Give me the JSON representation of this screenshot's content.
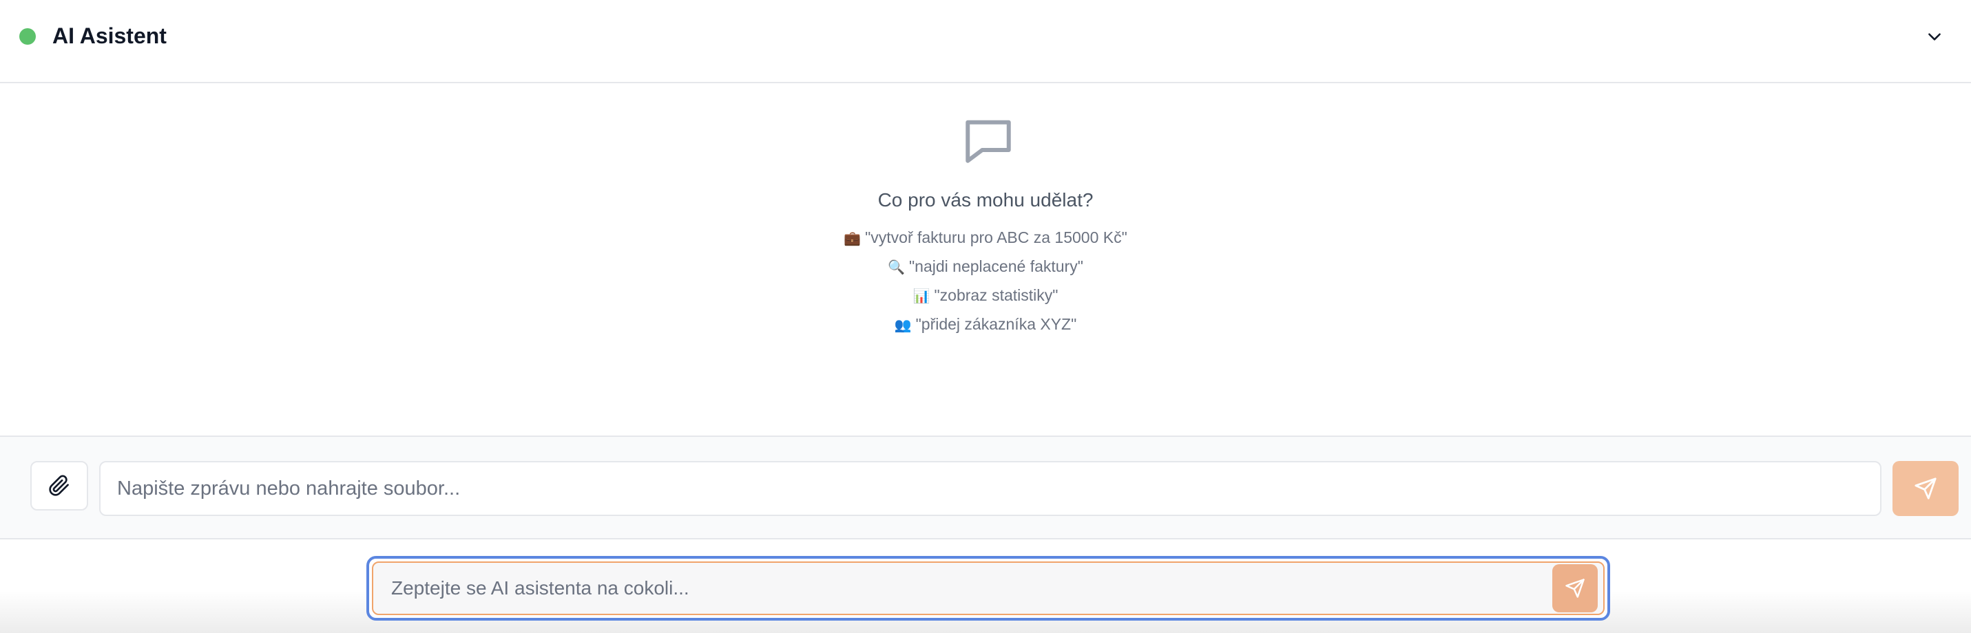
{
  "header": {
    "title": "AI Asistent",
    "status_color": "#5cc16b",
    "status_icon": "online-dot",
    "collapse_icon": "chevron-down-icon"
  },
  "empty_state": {
    "icon": "chat-bubble-icon",
    "heading": "Co pro vás mohu udělat?",
    "examples": [
      {
        "emoji": "💼",
        "text": "\"vytvoř fakturu pro ABC za 15000 Kč\""
      },
      {
        "emoji": "🔍",
        "text": "\"najdi neplacené faktury\""
      },
      {
        "emoji": "📊",
        "text": "\"zobraz statistiky\""
      },
      {
        "emoji": "👥",
        "text": "\"přidej zákazníka XYZ\""
      }
    ]
  },
  "composer": {
    "attach_icon": "paperclip-icon",
    "input_value": "",
    "input_placeholder": "Napište zprávu nebo nahrajte soubor...",
    "send_icon": "send-icon",
    "send_color": "#f3c09d"
  },
  "ask_bar": {
    "input_value": "",
    "input_placeholder": "Zeptejte se AI asistenta na cokoli...",
    "send_icon": "send-icon",
    "focus_color": "#5b86e0",
    "accent_color": "#f0a46b"
  }
}
